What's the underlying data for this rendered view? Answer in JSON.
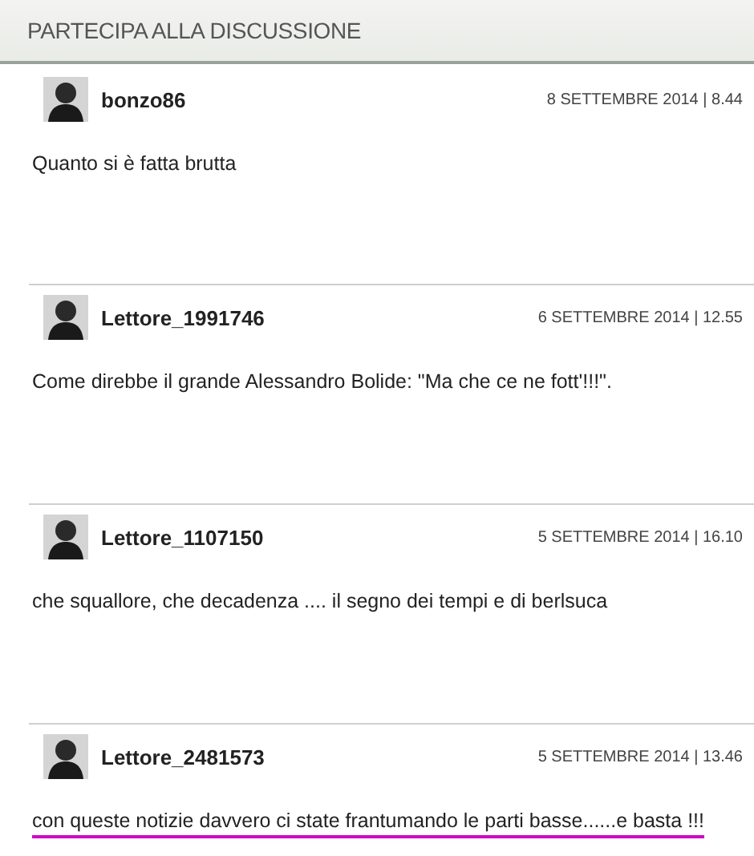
{
  "section_title": "PARTECIPA ALLA DISCUSSIONE",
  "comments": [
    {
      "author": "bonzo86",
      "date": "8 SETTEMBRE 2014 | 8.44",
      "text": "Quanto si è fatta brutta",
      "highlighted": false
    },
    {
      "author": "Lettore_1991746",
      "date": "6 SETTEMBRE 2014 | 12.55",
      "text": "Come direbbe il grande Alessandro Bolide: \"Ma che ce ne fott'!!!\".",
      "highlighted": false
    },
    {
      "author": "Lettore_1107150",
      "date": "5 SETTEMBRE 2014 | 16.10",
      "text": "che squallore, che decadenza .... il segno dei tempi e di berlsuca",
      "highlighted": false
    },
    {
      "author": "Lettore_2481573",
      "date": "5 SETTEMBRE 2014 | 13.46",
      "text": "con queste notizie davvero ci state frantumando le parti basse......e basta !!!",
      "highlighted": true
    }
  ]
}
